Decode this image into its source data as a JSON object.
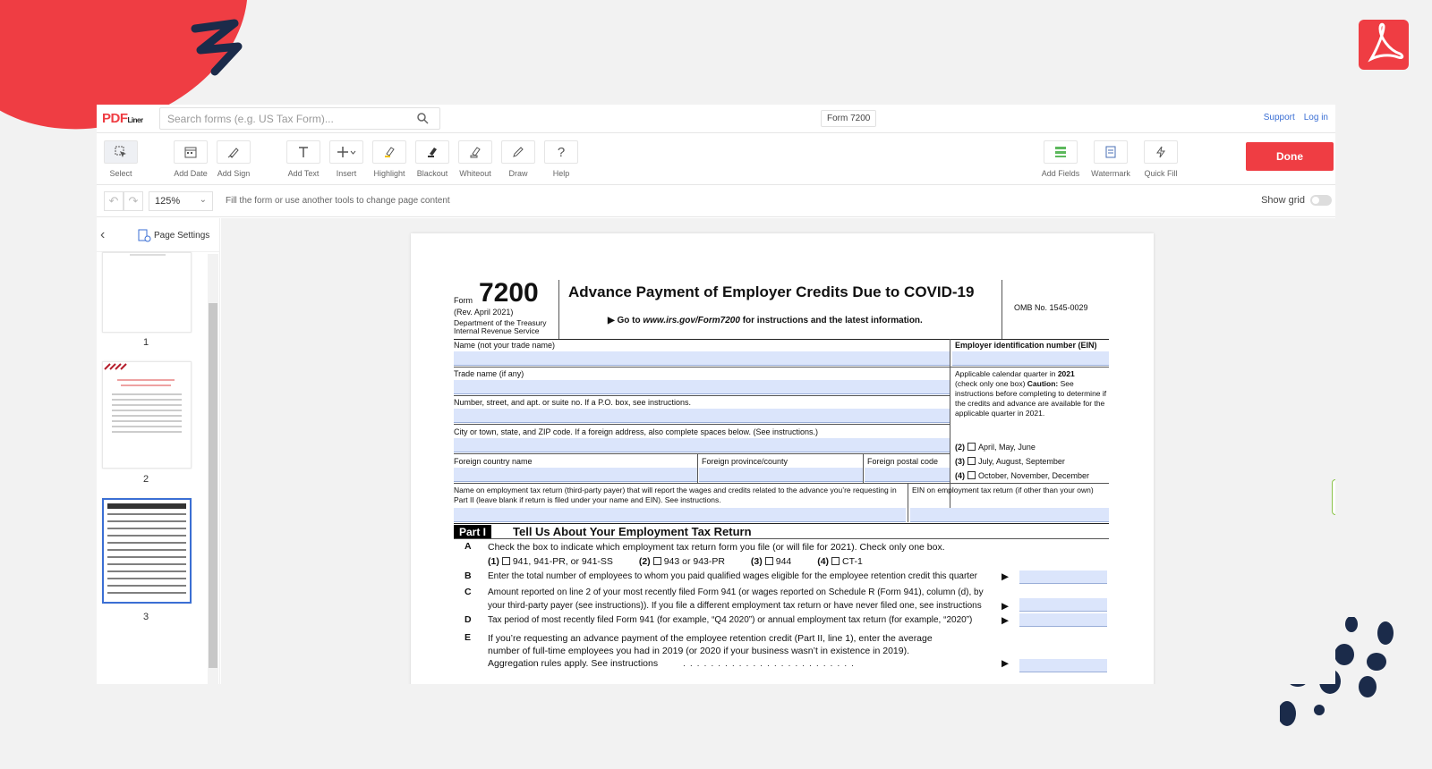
{
  "app": {
    "brand": "PDF",
    "brand_suffix": "Liner",
    "search_placeholder": "Search forms (e.g. US Tax Form)...",
    "document_title": "Form 7200",
    "links": [
      "Support",
      "Log in"
    ]
  },
  "toolbar": {
    "tools": [
      {
        "label": "Select",
        "icon": "cursor-icon"
      },
      {
        "label": "Add Date",
        "icon": "calendar-icon"
      },
      {
        "label": "Add Sign",
        "icon": "pen-sign-icon"
      },
      {
        "label": "Add Text",
        "icon": "text-icon"
      },
      {
        "label": "Insert",
        "icon": "plus-icon"
      },
      {
        "label": "Highlight",
        "icon": "highlighter-icon"
      },
      {
        "label": "Blackout",
        "icon": "blackout-icon"
      },
      {
        "label": "Whiteout",
        "icon": "eraser-icon"
      },
      {
        "label": "Draw",
        "icon": "pencil-icon"
      },
      {
        "label": "Help",
        "icon": "question-icon"
      }
    ],
    "right_tools": [
      {
        "label": "Add Fields",
        "icon": "fields-icon"
      },
      {
        "label": "Watermark",
        "icon": "watermark-icon"
      },
      {
        "label": "Quick Fill",
        "icon": "lightning-icon"
      }
    ],
    "done_label": "Done"
  },
  "subbar": {
    "zoom": "125%",
    "hint": "Fill the form or use another tools to change page content",
    "show_grid_label": "Show grid"
  },
  "sidebar": {
    "page_settings_label": "Page Settings",
    "pages": [
      "1",
      "2",
      "3"
    ]
  },
  "form": {
    "form_word": "Form",
    "form_number": "7200",
    "revision": "(Rev. April 2021)",
    "dept": "Department of the Treasury",
    "irs": "Internal Revenue Service",
    "title": "Advance Payment of Employer Credits Due to COVID-19",
    "goto_prefix": "▶ Go to ",
    "goto_url": "www.irs.gov/Form7200",
    "goto_suffix": " for instructions and the latest information.",
    "omb": "OMB No. 1545-0029",
    "name_label": "Name (not your trade name)",
    "ein_label": "Employer identification number (EIN)",
    "trade_label": "Trade name (if any)",
    "quarter_text_a": "Applicable calendar quarter in ",
    "quarter_year": "2021",
    "quarter_text_b": "(check only one box) ",
    "caution": "Caution:",
    "quarter_text_c": " See instructions before completing to determine if the credits and advance are available for the applicable quarter in 2021.",
    "street_label": "Number, street, and apt. or suite no. If a P.O. box, see instructions.",
    "city_label": "City or town, state, and ZIP code. If a foreign address, also complete spaces below. (See instructions.)",
    "country_label": "Foreign country name",
    "province_label": "Foreign province/county",
    "postal_label": "Foreign postal code",
    "quarters": [
      {
        "num": "(2)",
        "label": "April, May, June"
      },
      {
        "num": "(3)",
        "label": "July, August, September"
      },
      {
        "num": "(4)",
        "label": "October, November, December"
      }
    ],
    "third_party_label": "Name on employment tax return (third-party payer) that will report the wages and credits related to the advance you’re requesting in Part II (leave blank if return is filed under your name and EIN). See instructions.",
    "ein_other_label": "EIN on employment tax return (if other than your own)",
    "part_label": "Part I",
    "part_title": "Tell Us About Your Employment Tax Return",
    "lines": {
      "A": "Check the box to indicate which employment tax return form you file (or will file for 2021). Check only one box.",
      "A_opts": [
        {
          "num": "(1)",
          "label": "941, 941-PR, or 941-SS"
        },
        {
          "num": "(2)",
          "label": "943 or 943-PR"
        },
        {
          "num": "(3)",
          "label": "944"
        },
        {
          "num": "(4)",
          "label": "CT-1"
        }
      ],
      "B": "Enter the total number of employees to whom you paid qualified wages eligible for the employee retention credit this quarter",
      "C1": "Amount reported on line 2 of your most recently filed Form 941 (or wages reported on Schedule R (Form 941), column (d), by",
      "C2": "your third-party payer (see instructions)). If you file a different employment tax return or have never filed one, see instructions",
      "D": "Tax period of most recently filed Form 941 (for example, “Q4 2020”) or annual employment tax return (for example, “2020”)",
      "E1": "If you’re requesting an advance payment of the employee retention credit (Part II, line 1), enter the average",
      "E2": "number of full-time employees you had in 2019 (or 2020 if your business wasn’t in existence in 2019).",
      "E3": "Aggregation rules apply. See instructions"
    },
    "letters": [
      "A",
      "B",
      "C",
      "D",
      "E"
    ],
    "arrow": "▶",
    "leader": ". . . . . . . . . . . . . . . . . . . . . . . . ."
  }
}
